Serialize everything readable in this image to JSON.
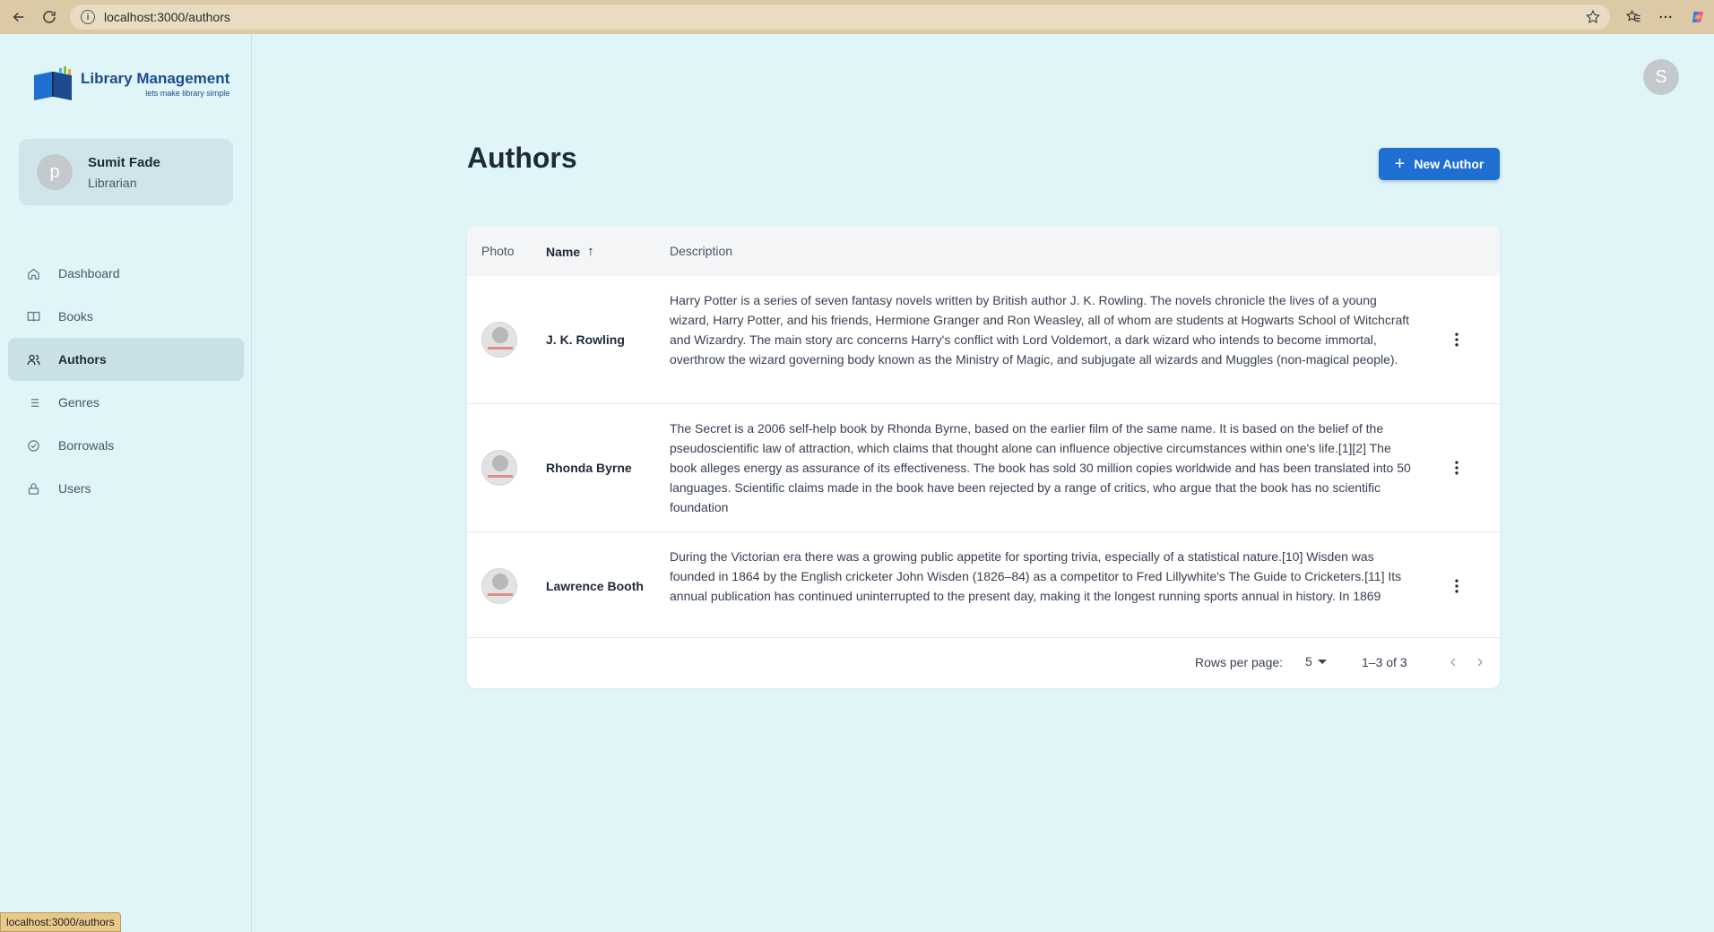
{
  "browser": {
    "url": "localhost:3000/authors",
    "status_url": "localhost:3000/authors"
  },
  "brand": {
    "title": "Library Management",
    "tagline": "lets make library simple",
    "accent": "#1f6fd1"
  },
  "profile": {
    "initial": "p",
    "name": "Sumit Fade",
    "role": "Librarian"
  },
  "header": {
    "avatar_initial": "S"
  },
  "sidebar": {
    "items": [
      {
        "label": "Dashboard",
        "icon": "home-icon"
      },
      {
        "label": "Books",
        "icon": "book-open-icon"
      },
      {
        "label": "Authors",
        "icon": "users-icon",
        "active": true
      },
      {
        "label": "Genres",
        "icon": "list-icon"
      },
      {
        "label": "Borrowals",
        "icon": "check-circle-icon"
      },
      {
        "label": "Users",
        "icon": "lock-icon"
      }
    ]
  },
  "main": {
    "title": "Authors",
    "new_button": "New Author",
    "table": {
      "columns": {
        "photo": "Photo",
        "name": "Name",
        "description": "Description"
      },
      "rows": [
        {
          "name": "J. K. Rowling",
          "description": "Harry Potter is a series of seven fantasy novels written by British author J. K. Rowling. The novels chronicle the lives of a young wizard, Harry Potter, and his friends, Hermione Granger and Ron Weasley, all of whom are students at Hogwarts School of Witchcraft and Wizardry. The main story arc concerns Harry's conflict with Lord Voldemort, a dark wizard who intends to become immortal, overthrow the wizard governing body known as the Ministry of Magic, and subjugate all wizards and Muggles (non-magical people)."
        },
        {
          "name": "Rhonda Byrne",
          "description": "The Secret is a 2006 self-help book by Rhonda Byrne, based on the earlier film of the same name. It is based on the belief of the pseudoscientific law of attraction, which claims that thought alone can influence objective circumstances within one's life.[1][2] The book alleges energy as assurance of its effectiveness. The book has sold 30 million copies worldwide and has been translated into 50 languages. Scientific claims made in the book have been rejected by a range of critics, who argue that the book has no scientific foundation"
        },
        {
          "name": "Lawrence Booth",
          "description": "During the Victorian era there was a growing public appetite for sporting trivia, especially of a statistical nature.[10] Wisden was founded in 1864 by the English cricketer John Wisden (1826–84) as a competitor to Fred Lillywhite's The Guide to Cricketers.[11] Its annual publication has continued uninterrupted to the present day, making it the longest running sports annual in history. In 1869"
        }
      ]
    },
    "pagination": {
      "rows_per_page_label": "Rows per page:",
      "rows_per_page": "5",
      "range": "1–3 of 3"
    }
  }
}
